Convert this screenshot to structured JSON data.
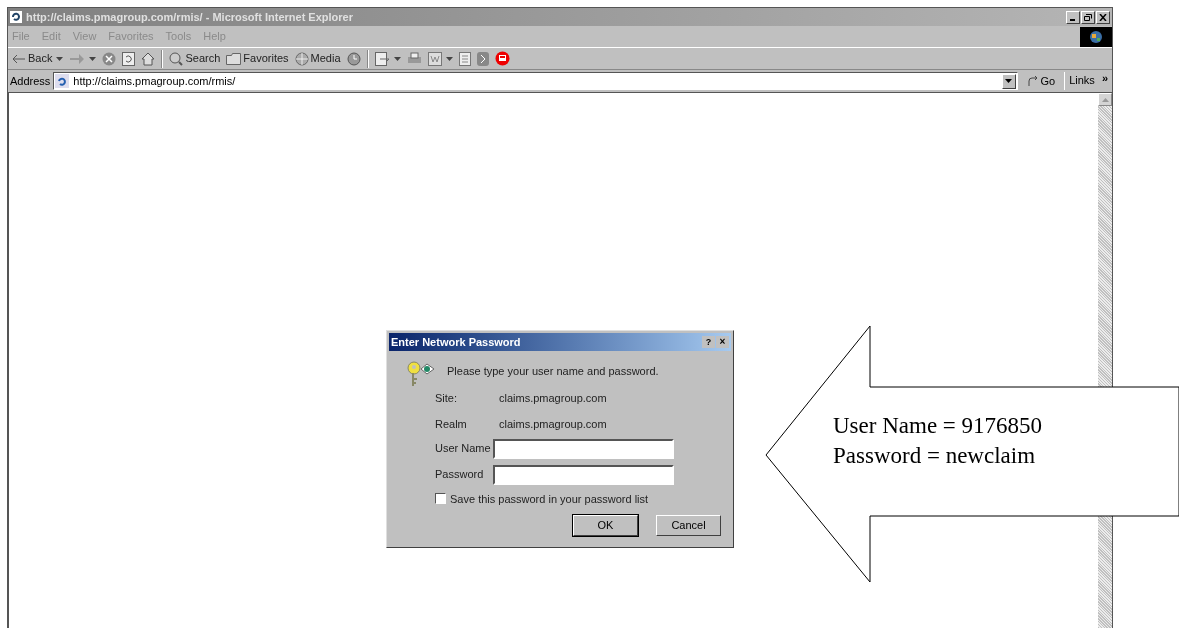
{
  "window": {
    "title": "http://claims.pmagroup.com/rmis/ - Microsoft Internet Explorer"
  },
  "menu": [
    "File",
    "Edit",
    "View",
    "Favorites",
    "Tools",
    "Help"
  ],
  "toolbar": {
    "back": "Back",
    "search": "Search",
    "favorites": "Favorites",
    "media": "Media"
  },
  "address": {
    "label": "Address",
    "value": "http://claims.pmagroup.com/rmis/",
    "go": "Go",
    "links": "Links",
    "more": "»"
  },
  "dialog": {
    "title": "Enter Network Password",
    "help": "?",
    "close": "×",
    "prompt": "Please type your user name and password.",
    "fields": [
      {
        "label": "Site:",
        "value": "claims.pmagroup.com"
      },
      {
        "label": "Realm",
        "value": "claims.pmagroup.com"
      }
    ],
    "inputs": [
      {
        "label": "User Name"
      },
      {
        "label": "Password"
      }
    ],
    "save": {
      "label": "Save this password in your password list",
      "checked": false
    },
    "buttons": [
      "OK",
      "Cancel"
    ]
  },
  "callout": {
    "lines": [
      "User Name = 9176850",
      "Password = newclaim"
    ]
  }
}
